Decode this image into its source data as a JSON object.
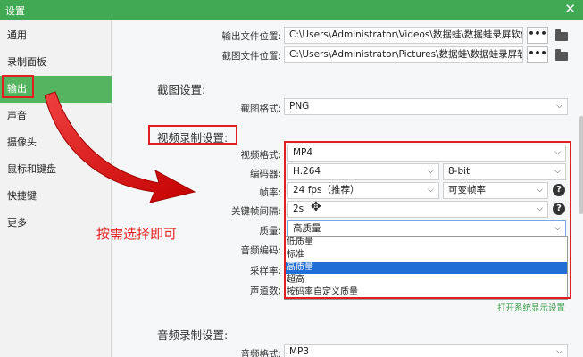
{
  "window": {
    "title": "设置",
    "close_glyph": "✕"
  },
  "sidebar": {
    "items": [
      {
        "label": "通用"
      },
      {
        "label": "录制面板"
      },
      {
        "label": "输出"
      },
      {
        "label": "声音"
      },
      {
        "label": "摄像头"
      },
      {
        "label": "鼠标和键盘"
      },
      {
        "label": "快捷键"
      },
      {
        "label": "更多"
      }
    ],
    "active_index": 2
  },
  "output": {
    "video_folder_label": "输出文件位置:",
    "video_folder_value": "C:\\Users\\Administrator\\Videos\\数据蛙\\数据蛙录屏软件",
    "screenshot_folder_label": "截图文件位置:",
    "screenshot_folder_value": "C:\\Users\\Administrator\\Pictures\\数据蛙\\数据蛙录屏软件",
    "browse_glyph": "•••"
  },
  "screenshot_settings": {
    "title": "截图设置:",
    "format_label": "截图格式:",
    "format_value": "PNG"
  },
  "video_settings": {
    "title": "视频录制设置:",
    "format_label": "视频格式:",
    "format_value": "MP4",
    "encoder_label": "编码器:",
    "encoder_value": "H.264",
    "bitdepth_value": "8-bit",
    "fps_label": "帧率:",
    "fps_value": "24 fps（推荐）",
    "fps_mode_value": "可变帧率",
    "keyframe_label": "关键帧间隔:",
    "keyframe_value": "2s",
    "quality_label": "质量:",
    "quality_value": "高质量",
    "audio_codec_label": "音频编码:",
    "sample_rate_label": "采样率:",
    "channels_label": "声道数:",
    "help_glyph": "?",
    "quality_options": [
      "低质量",
      "标准",
      "高质量",
      "超高",
      "按码率自定义质量"
    ],
    "quality_selected_index": 2
  },
  "links": {
    "open_system_display": "打开系统显示设置"
  },
  "audio_settings": {
    "title": "音频录制设置:",
    "format_label": "音频格式:",
    "format_value": "MP3"
  },
  "annotation": {
    "text": "按需选择即可",
    "color": "#e52020"
  },
  "colors": {
    "accent": "#55b460",
    "titlebar": "#41a954",
    "selection": "#1f6fd6"
  }
}
